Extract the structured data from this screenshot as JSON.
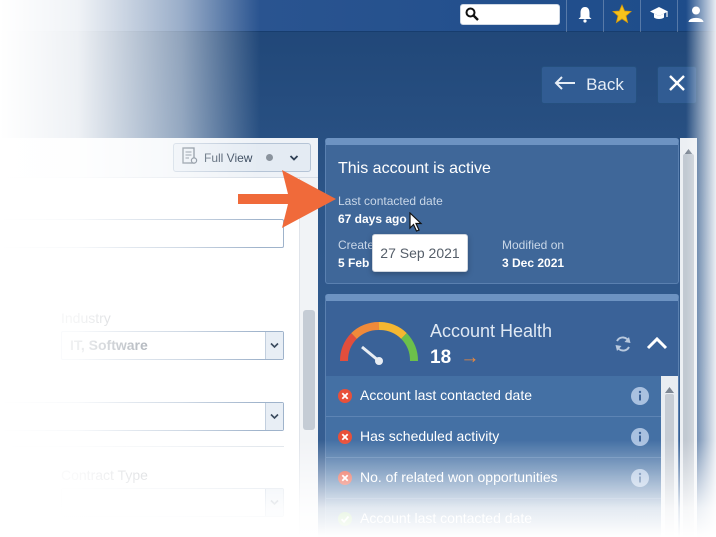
{
  "topbar": {
    "search_placeholder": "",
    "icons": [
      "search-icon",
      "bell-icon",
      "star-icon",
      "graduation-cap-icon",
      "user-icon"
    ]
  },
  "nav": {
    "back_label": "Back",
    "close_icon": "close-icon"
  },
  "form": {
    "view_button_label": "Full View",
    "industry_label": "Industry",
    "industry_value": "IT, Software",
    "contract_type_label": "Contract Type"
  },
  "status_card": {
    "title": "This account is active",
    "last_contacted_label": "Last contacted date",
    "last_contacted_value": "67 days ago",
    "created_label": "Create",
    "created_value": "5 Feb 2",
    "modified_label": "Modified on",
    "modified_value": "3 Dec 2021",
    "tooltip": "27 Sep 2021"
  },
  "health_card": {
    "title": "Account Health",
    "score": "18",
    "trend_arrow": "→",
    "items": [
      {
        "label": "Account last contacted date",
        "status": "fail"
      },
      {
        "label": "Has scheduled activity",
        "status": "fail"
      },
      {
        "label": "No. of related won opportunities",
        "status": "fail"
      },
      {
        "label": "Account last contacted date",
        "status": "pass"
      }
    ]
  },
  "colors": {
    "accent_orange": "#f06a3a",
    "fail_red": "#e8503a",
    "pass_green": "#6cc04a",
    "panel_blue": "#3f6799"
  }
}
